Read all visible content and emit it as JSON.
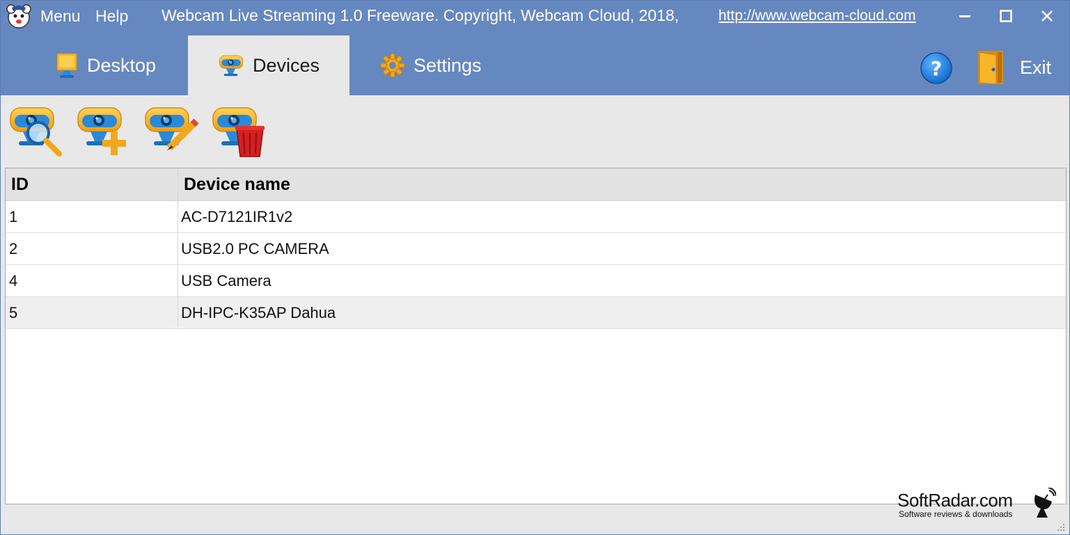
{
  "titlebar": {
    "menu_label": "Menu",
    "help_label": "Help",
    "title": "Webcam Live Streaming 1.0 Freeware. Copyright, Webcam Cloud, 2018,",
    "link": "http://www.webcam-cloud.com",
    "controls": {
      "minimize_icon": "minimize-icon",
      "maximize_icon": "maximize-icon",
      "close_icon": "close-icon"
    }
  },
  "tabs": [
    {
      "label": "Desktop",
      "icon": "monitor-icon",
      "active": false
    },
    {
      "label": "Devices",
      "icon": "webcam-icon",
      "active": true
    },
    {
      "label": "Settings",
      "icon": "gear-icon",
      "active": false
    }
  ],
  "header_actions": {
    "help_icon": "help-icon",
    "exit_label": "Exit",
    "exit_icon": "door-icon"
  },
  "toolbar": [
    {
      "icon": "webcam-search-icon",
      "action": "search devices"
    },
    {
      "icon": "webcam-add-icon",
      "action": "add device"
    },
    {
      "icon": "webcam-edit-icon",
      "action": "edit device"
    },
    {
      "icon": "webcam-delete-icon",
      "action": "delete device"
    }
  ],
  "table": {
    "columns": [
      "ID",
      "Device name"
    ],
    "rows": [
      {
        "id": "1",
        "name": "AC-D7121IR1v2",
        "selected": false
      },
      {
        "id": "2",
        "name": "USB2.0 PC CAMERA",
        "selected": false
      },
      {
        "id": "4",
        "name": "USB Camera",
        "selected": false
      },
      {
        "id": "5",
        "name": "DH-IPC-K35AP Dahua",
        "selected": true
      }
    ]
  },
  "watermark": {
    "title": "SoftRadar.com",
    "subtitle": "Software reviews & downloads"
  },
  "colors": {
    "header_blue": "#6688c0",
    "tab_active_bg": "#e8e8e8",
    "help_blue": "#1a7fe0",
    "cam_yellow": "#f7b52a",
    "cam_blue": "#2a8ad8"
  }
}
